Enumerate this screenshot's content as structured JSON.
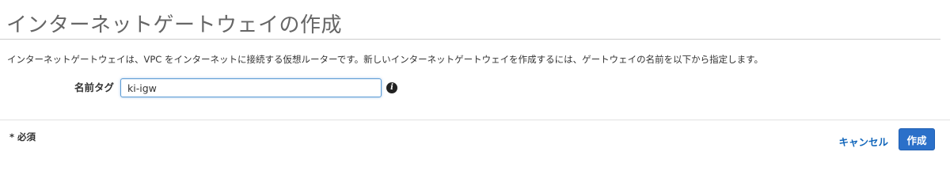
{
  "page": {
    "title": "インターネットゲートウェイの作成",
    "description": "インターネットゲートウェイは、VPC をインターネットに接続する仮想ルーターです。新しいインターネットゲートウェイを作成するには、ゲートウェイの名前を以下から指定します。"
  },
  "form": {
    "name_tag_label": "名前タグ",
    "name_tag_value": "ki-igw",
    "info_icon": "info-circle-icon"
  },
  "footer": {
    "required_note": "* 必須",
    "cancel_label": "キャンセル",
    "create_label": "作成"
  },
  "colors": {
    "primary_button": "#2b70c9",
    "link": "#1166bb",
    "input_focus_border": "#5b9bd5"
  }
}
